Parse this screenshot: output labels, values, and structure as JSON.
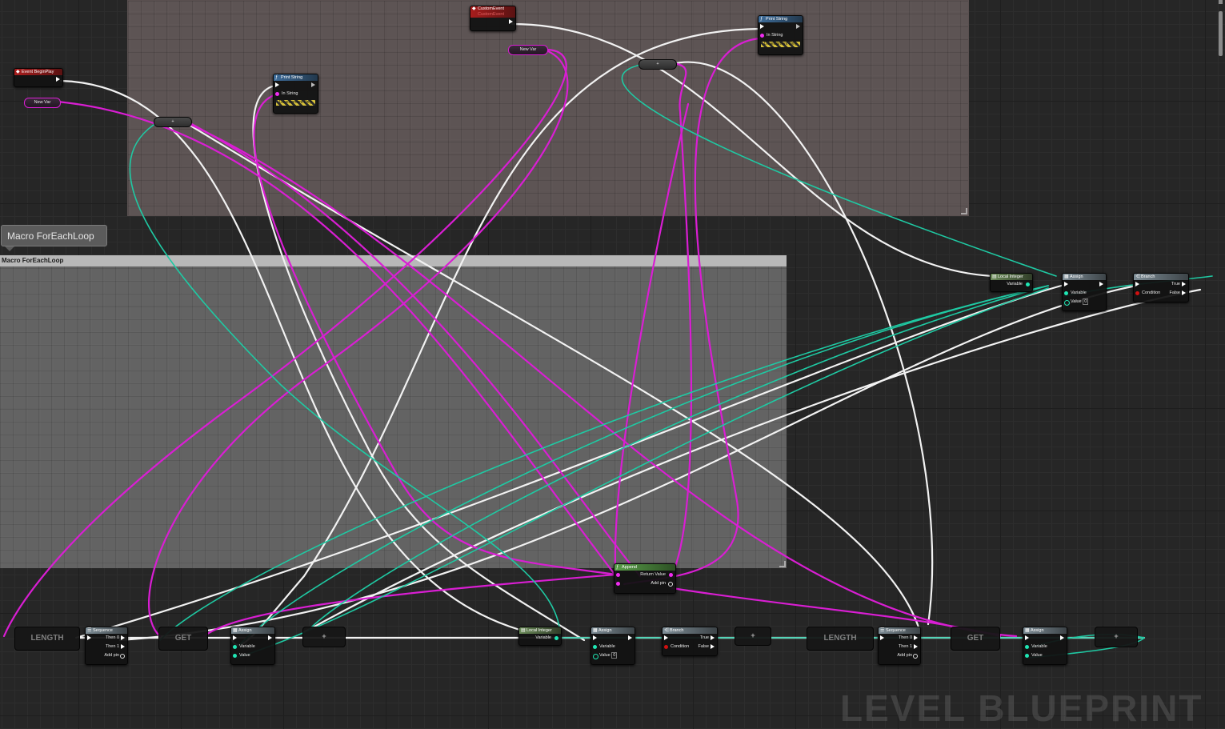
{
  "comments": {
    "macro_bubble": "Macro ForEachLoop",
    "macro_header": "Macro ForEachLoop"
  },
  "nodes": {
    "event_begin_play": {
      "title": "Event BeginPlay"
    },
    "new_var_1": {
      "label": "New Var"
    },
    "new_var_2": {
      "label": "New Var"
    },
    "custom_event": {
      "title": "CustomEvent",
      "subtitle": "CustomEvent"
    },
    "print_string_1": {
      "title": "Print String",
      "in_string": "In String",
      "dev_only": "Development Only"
    },
    "print_string_2": {
      "title": "Print String",
      "in_string": "In String",
      "dev_only": "Development Only"
    },
    "append": {
      "title": "Append",
      "return_value": "Return Value",
      "add_pin": "Add pin"
    },
    "local_integer_1": {
      "title": "Local Integer",
      "variable": "Variable"
    },
    "local_integer_2": {
      "title": "Local Integer",
      "variable": "Variable"
    },
    "assign_1": {
      "title": "Assign",
      "variable": "Variable",
      "value": "Value",
      "value_default": "0"
    },
    "assign_2": {
      "title": "Assign",
      "variable": "Variable",
      "value": "Value"
    },
    "assign_3": {
      "title": "Assign",
      "variable": "Variable",
      "value": "Value",
      "value_default": "0"
    },
    "assign_4": {
      "title": "Assign",
      "variable": "Variable",
      "value": "Value"
    },
    "branch_1": {
      "title": "Branch",
      "condition": "Condition",
      "true": "True",
      "false": "False"
    },
    "branch_2": {
      "title": "Branch",
      "condition": "Condition",
      "true": "True",
      "false": "False"
    },
    "sequence_1": {
      "title": "Sequence",
      "then0": "Then 0",
      "then1": "Then 1",
      "add_pin": "Add pin"
    },
    "sequence_2": {
      "title": "Sequence",
      "then0": "Then 0",
      "then1": "Then 1",
      "add_pin": "Add pin"
    },
    "length_1": {
      "label": "LENGTH"
    },
    "length_2": {
      "label": "LENGTH"
    },
    "get_1": {
      "label": "GET"
    },
    "get_2": {
      "label": "GET"
    },
    "add_1": {
      "label": "+"
    },
    "add_2": {
      "label": "+"
    },
    "add_3": {
      "label": "+"
    }
  },
  "watermark": "LEVEL BLUEPRINT",
  "colors": {
    "exec_wire": "#f2f2f2",
    "string_wire": "#d91ed3",
    "integer_wire": "#1fc9a3",
    "bool_pin": "#d01010",
    "event_header": "#a81d1d",
    "function_header": "#3d6c9a"
  }
}
